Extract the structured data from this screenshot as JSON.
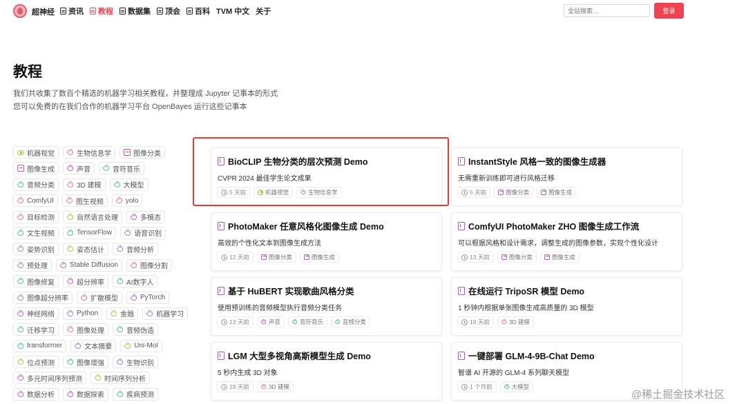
{
  "nav": {
    "brand": "超神经",
    "items": [
      {
        "label": "资讯",
        "active": false
      },
      {
        "label": "教程",
        "active": true
      },
      {
        "label": "数据集",
        "active": false
      },
      {
        "label": "顶会",
        "active": false
      },
      {
        "label": "百科",
        "active": false
      },
      {
        "label": "TVM 中文",
        "active": false,
        "no_icon": true
      },
      {
        "label": "关于",
        "active": false,
        "no_icon": true
      }
    ],
    "search_placeholder": "全站搜索…",
    "login_label": "登录"
  },
  "header": {
    "title": "教程",
    "desc_line1": "我们共收集了数百个精选的机器学习相关教程，并整理成 Jupyter 记事本的形式",
    "desc_line2": "您可以免费的在我们合作的机器学习平台 OpenBayes 运行这些记事本"
  },
  "tags": [
    [
      {
        "label": "机器视觉",
        "icon": "eye",
        "color": "#a3b820"
      },
      {
        "label": "生物信息学",
        "icon": "label",
        "color": "#e8606b"
      },
      {
        "label": "图像分类",
        "icon": "img",
        "color": "#c54fc9"
      }
    ],
    [
      {
        "label": "图像生成",
        "icon": "img",
        "color": "#c54fc9"
      },
      {
        "label": "声音",
        "icon": "label",
        "color": "#b040d0"
      },
      {
        "label": "音符音乐",
        "icon": "label",
        "color": "#2ab39b"
      }
    ],
    [
      {
        "label": "音频分类",
        "icon": "label",
        "color": "#2ab39b"
      },
      {
        "label": "3D 建模",
        "icon": "label",
        "color": "#e8606b"
      },
      {
        "label": "大模型",
        "icon": "label",
        "color": "#2ab39b"
      }
    ],
    [
      {
        "label": "ComfyUI",
        "icon": "label",
        "color": "#e8606b"
      },
      {
        "label": "图生视频",
        "icon": "label",
        "color": "#e8606b"
      },
      {
        "label": "yolo",
        "icon": "label",
        "color": "#e8606b"
      }
    ],
    [
      {
        "label": "目标检测",
        "icon": "label",
        "color": "#e8606b"
      },
      {
        "label": "自然语言处理",
        "icon": "label",
        "color": "#a3b820"
      },
      {
        "label": "多模态",
        "icon": "label",
        "color": "#b040d0"
      }
    ],
    [
      {
        "label": "文生视频",
        "icon": "label",
        "color": "#2ab39b"
      },
      {
        "label": "TensorFlow",
        "icon": "label",
        "color": "#2ab39b"
      },
      {
        "label": "语音识别",
        "icon": "label",
        "color": "#6b7bd6"
      }
    ],
    [
      {
        "label": "姿势识别",
        "icon": "label",
        "color": "#6b7bd6"
      },
      {
        "label": "姿态估计",
        "icon": "label",
        "color": "#a3b820"
      },
      {
        "label": "音频分析",
        "icon": "label",
        "color": "#6b7bd6"
      }
    ],
    [
      {
        "label": "预处理",
        "icon": "label",
        "color": "#6b7bd6"
      },
      {
        "label": "Stable Diffusion",
        "icon": "label",
        "color": "#b040d0"
      },
      {
        "label": "图像分割",
        "icon": "label",
        "color": "#e8606b"
      }
    ],
    [
      {
        "label": "图像修复",
        "icon": "label",
        "color": "#2ab39b"
      },
      {
        "label": "超分辨率",
        "icon": "label",
        "color": "#b040d0"
      },
      {
        "label": "AI数字人",
        "icon": "label",
        "color": "#2ab39b"
      }
    ],
    [
      {
        "label": "图像超分辨率",
        "icon": "label",
        "color": "#6b7bd6"
      },
      {
        "label": "扩散模型",
        "icon": "label",
        "color": "#e8606b"
      },
      {
        "label": "PyTorch",
        "icon": "label",
        "color": "#b040d0"
      }
    ],
    [
      {
        "label": "神经网络",
        "icon": "label",
        "color": "#b040d0"
      },
      {
        "label": "Python",
        "icon": "label",
        "color": "#6b7bd6"
      },
      {
        "label": "金融",
        "icon": "label",
        "color": "#a3b820"
      },
      {
        "label": "机器学习",
        "icon": "label",
        "color": "#6b7bd6"
      }
    ],
    [
      {
        "label": "迁移学习",
        "icon": "label",
        "color": "#2ab39b"
      },
      {
        "label": "图像处理",
        "icon": "label",
        "color": "#e8606b"
      },
      {
        "label": "音频伪造",
        "icon": "label",
        "color": "#2ab39b"
      }
    ],
    [
      {
        "label": "transformer",
        "icon": "label",
        "color": "#2ab39b"
      },
      {
        "label": "文本摘要",
        "icon": "label",
        "color": "#6b7bd6"
      },
      {
        "label": "Uni-Mol",
        "icon": "label",
        "color": "#a3b820"
      }
    ],
    [
      {
        "label": "位点预测",
        "icon": "label",
        "color": "#a3b820"
      },
      {
        "label": "图像增强",
        "icon": "label",
        "color": "#2ab39b"
      },
      {
        "label": "生物识别",
        "icon": "label",
        "color": "#6b7bd6"
      }
    ],
    [
      {
        "label": "多元时间序列预测",
        "icon": "label",
        "color": "#b040d0"
      },
      {
        "label": "时间序列分析",
        "icon": "label",
        "color": "#a3b820"
      }
    ],
    [
      {
        "label": "数据分析",
        "icon": "label",
        "color": "#b040d0"
      },
      {
        "label": "数据探索",
        "icon": "label",
        "color": "#b040d0"
      },
      {
        "label": "疾病预测",
        "icon": "label",
        "color": "#2ab39b"
      }
    ]
  ],
  "cards": [
    {
      "title": "BioCLIP 生物分类的层次预测 Demo",
      "subtitle": "CVPR 2024 最佳学生论文成果",
      "time": "5 天前",
      "tags": [
        {
          "label": "机器视觉",
          "icon": "eye",
          "color": "#a3b820"
        },
        {
          "label": "生物信息学",
          "icon": "label",
          "color": "#e8606b"
        }
      ]
    },
    {
      "title": "InstantStyle 风格一致的图像生成器",
      "subtitle": "无需重新训练即可进行风格迁移",
      "time": "5 天前",
      "tags": [
        {
          "label": "图像分类",
          "icon": "img",
          "color": "#c54fc9"
        },
        {
          "label": "图像生成",
          "icon": "img",
          "color": "#c54fc9"
        }
      ]
    },
    {
      "title": "PhotoMaker 任意风格化图像生成 Demo",
      "subtitle": "高效的个性化文本到图像生成方法",
      "time": "12 天前",
      "tags": [
        {
          "label": "图像分类",
          "icon": "img",
          "color": "#c54fc9"
        },
        {
          "label": "图像生成",
          "icon": "img",
          "color": "#c54fc9"
        }
      ]
    },
    {
      "title": "ComfyUI PhotoMaker ZHO 图像生成工作流",
      "subtitle": "可以根据风格和设计需求，调整生成的图像参数，实现个性化设计",
      "time": "13 天前",
      "tags": [
        {
          "label": "图像分类",
          "icon": "img",
          "color": "#c54fc9"
        },
        {
          "label": "图像生成",
          "icon": "img",
          "color": "#c54fc9"
        }
      ]
    },
    {
      "title": "基于 HuBERT 实现歌曲风格分类",
      "subtitle": "使用预训练的音频模型执行音频分类任务",
      "time": "13 天前",
      "tags": [
        {
          "label": "声音",
          "icon": "label",
          "color": "#b040d0"
        },
        {
          "label": "音符音乐",
          "icon": "label",
          "color": "#2ab39b"
        },
        {
          "label": "音频分类",
          "icon": "label",
          "color": "#2ab39b"
        }
      ]
    },
    {
      "title": "在线运行 TripoSR 模型 Demo",
      "subtitle": "1 秒钟内根据单张图像生成高质量的 3D 模型",
      "time": "19 天前",
      "tags": [
        {
          "label": "3D 建模",
          "icon": "label",
          "color": "#e8606b"
        }
      ]
    },
    {
      "title": "LGM 大型多视角高斯模型生成 Demo",
      "subtitle": "5 秒内生成 3D 对象",
      "time": "19 天前",
      "tags": [
        {
          "label": "3D 建模",
          "icon": "label",
          "color": "#e8606b"
        }
      ]
    },
    {
      "title": "一键部署 GLM-4-9B-Chat Demo",
      "subtitle": "智谱 AI 开源的 GLM-4 系列聊天模型",
      "time": "1 个月前",
      "tags": [
        {
          "label": "大模型",
          "icon": "label",
          "color": "#2ab39b"
        }
      ]
    }
  ],
  "watermark": "@稀土掘金技术社区"
}
